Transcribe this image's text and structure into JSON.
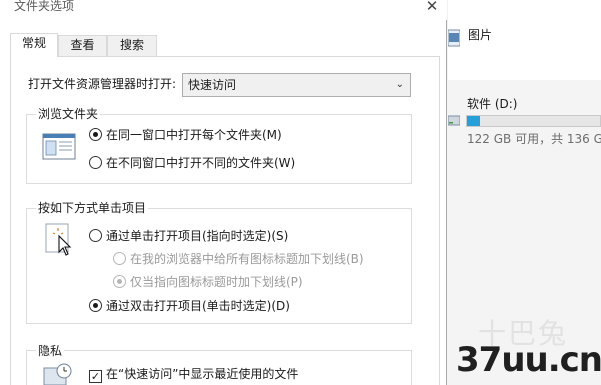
{
  "dialog": {
    "title": "文件夹选项",
    "close_glyph": "✕",
    "tabs": [
      {
        "label": "常规",
        "active": true
      },
      {
        "label": "查看",
        "active": false
      },
      {
        "label": "搜索",
        "active": false
      }
    ],
    "open_explorer_label": "打开文件资源管理器时打开:",
    "open_explorer_value": "快速访问",
    "browse_group": {
      "title": "浏览文件夹",
      "options": [
        {
          "label": "在同一窗口中打开每个文件夹(M)",
          "checked": true
        },
        {
          "label": "在不同窗口中打开不同的文件夹(W)",
          "checked": false
        }
      ]
    },
    "click_group": {
      "title": "按如下方式单击项目",
      "options": [
        {
          "label": "通过单击打开项目(指向时选定)(S)",
          "checked": false,
          "disabled": false
        },
        {
          "label": "在我的浏览器中给所有图标标题加下划线(B)",
          "checked": false,
          "disabled": true
        },
        {
          "label": "仅当指向图标标题时加下划线(P)",
          "checked": true,
          "disabled": true
        },
        {
          "label": "通过双击打开项目(单击时选定)(D)",
          "checked": true,
          "disabled": false
        }
      ]
    },
    "privacy_group": {
      "title": "隐私",
      "options": [
        {
          "label": "在“快速访问”中显示最近使用的文件",
          "checked": true
        }
      ]
    }
  },
  "explorer": {
    "pictures_label": "图片",
    "drive_label": "软件 (D:)",
    "drive_info": "122 GB 可用，共 136 GB",
    "drive_used_fraction": 0.1
  },
  "watermark": {
    "faint": "十巴兔",
    "text": "37uu.cn"
  },
  "colors": {
    "accent": "#26a0da",
    "border": "#d9d9d9"
  }
}
